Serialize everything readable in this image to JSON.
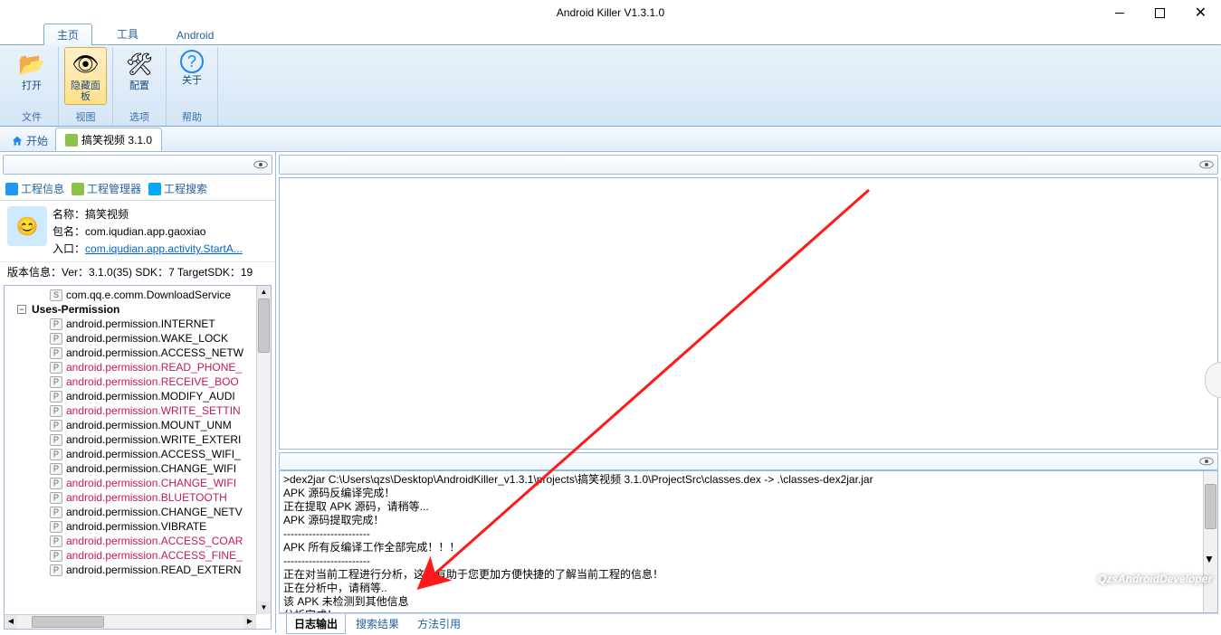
{
  "window": {
    "title": "Android Killer V1.3.1.0"
  },
  "ribbon_tabs": [
    "主页",
    "工具",
    "Android"
  ],
  "ribbon": {
    "groups": [
      {
        "label": "文件",
        "items": [
          {
            "icon": "📂",
            "label": "打开"
          }
        ]
      },
      {
        "label": "视图",
        "items": [
          {
            "icon": "👁",
            "label": "隐藏面\n板",
            "selected": true
          }
        ]
      },
      {
        "label": "选项",
        "items": [
          {
            "icon": "🛠",
            "label": "配置"
          }
        ]
      },
      {
        "label": "帮助",
        "items": [
          {
            "icon": "？",
            "label": "关于"
          }
        ]
      }
    ]
  },
  "doc_tabs": {
    "home": "开始",
    "active": "搞笑视频 3.1.0"
  },
  "sub_tabs": [
    "工程信息",
    "工程管理器",
    "工程搜索"
  ],
  "project": {
    "name_label": "名称：",
    "name": "搞笑视频",
    "pkg_label": "包名：",
    "pkg": "com.iqudian.app.gaoxiao",
    "entry_label": "入口：",
    "entry": "com.iqudian.app.activity.StartA...",
    "version_label": "版本信息：",
    "version": "Ver：3.1.0(35) SDK：7 TargetSDK：19"
  },
  "tree": {
    "svc_row": "com.qq.e.comm.DownloadService",
    "group": "Uses-Permission",
    "perms": [
      {
        "t": "android.permission.INTERNET",
        "pink": false
      },
      {
        "t": "android.permission.WAKE_LOCK",
        "pink": false
      },
      {
        "t": "android.permission.ACCESS_NETW",
        "pink": false
      },
      {
        "t": "android.permission.READ_PHONE_",
        "pink": true
      },
      {
        "t": "android.permission.RECEIVE_BOO",
        "pink": true
      },
      {
        "t": "android.permission.MODIFY_AUDI",
        "pink": false
      },
      {
        "t": "android.permission.WRITE_SETTIN",
        "pink": true
      },
      {
        "t": "android.permission.MOUNT_UNM",
        "pink": false
      },
      {
        "t": "android.permission.WRITE_EXTERI",
        "pink": false
      },
      {
        "t": "android.permission.ACCESS_WIFI_",
        "pink": false
      },
      {
        "t": "android.permission.CHANGE_WIFI",
        "pink": false
      },
      {
        "t": "android.permission.CHANGE_WIFI",
        "pink": true
      },
      {
        "t": "android.permission.BLUETOOTH",
        "pink": true
      },
      {
        "t": "android.permission.CHANGE_NETV",
        "pink": false
      },
      {
        "t": "android.permission.VIBRATE",
        "pink": false
      },
      {
        "t": "android.permission.ACCESS_COAR",
        "pink": true
      },
      {
        "t": "android.permission.ACCESS_FINE_",
        "pink": true
      },
      {
        "t": "android.permission.READ_EXTERN",
        "pink": false
      }
    ]
  },
  "log_lines": [
    ">dex2jar C:\\Users\\qzs\\Desktop\\AndroidKiller_v1.3.1\\projects\\搞笑视频 3.1.0\\ProjectSrc\\classes.dex -> .\\classes-dex2jar.jar",
    "APK 源码反编译完成！",
    "正在提取 APK 源码，请稍等...",
    "APK 源码提取完成！",
    "------------------------",
    "APK 所有反编译工作全部完成！！！",
    "------------------------",
    "正在对当前工程进行分析，这将有助于您更加方便快捷的了解当前工程的信息！",
    "正在分析中，请稍等..",
    "该 APK 未检测到其他信息",
    "分析完成！"
  ],
  "log_tabs": [
    "日志输出",
    "搜索结果",
    "方法引用"
  ],
  "watermark": "QzsAndroidDeveloper"
}
